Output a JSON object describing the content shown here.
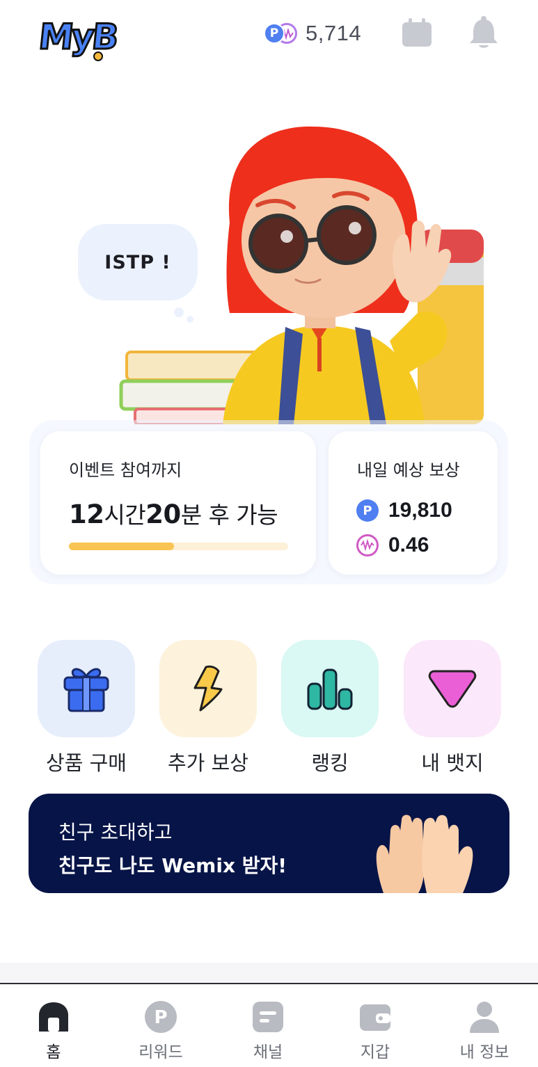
{
  "header": {
    "logo_text": "MyB",
    "points": "5,714"
  },
  "hero": {
    "bubble_text": "ISTP !"
  },
  "event_card": {
    "title": "이벤트 참여까지",
    "time_hours": "12",
    "time_hours_unit": "시간",
    "time_minutes": "20",
    "time_minutes_unit": "분 후 가능",
    "progress": 0.48
  },
  "reward_card": {
    "title": "내일 예상 보상",
    "point_reward": "19,810",
    "wemix_reward": "0.46"
  },
  "quick_menu": {
    "items": [
      {
        "label": "상품 구매",
        "icon": "gift-icon"
      },
      {
        "label": "추가 보상",
        "icon": "lightning-icon"
      },
      {
        "label": "랭킹",
        "icon": "ranking-chart-icon"
      },
      {
        "label": "내 뱃지",
        "icon": "badge-icon"
      }
    ]
  },
  "banner": {
    "line1": "친구 초대하고",
    "line2": "친구도 나도 Wemix 받자!"
  },
  "tabbar": {
    "items": [
      {
        "label": "홈",
        "icon": "home-icon",
        "active": true
      },
      {
        "label": "리워드",
        "icon": "reward-icon",
        "active": false
      },
      {
        "label": "채널",
        "icon": "channel-icon",
        "active": false
      },
      {
        "label": "지갑",
        "icon": "wallet-icon",
        "active": false
      },
      {
        "label": "내 정보",
        "icon": "profile-icon",
        "active": false
      }
    ]
  },
  "colors": {
    "accent_blue": "#4f7ff0",
    "progress_yellow": "#f9c453",
    "banner_navy": "#071447"
  }
}
